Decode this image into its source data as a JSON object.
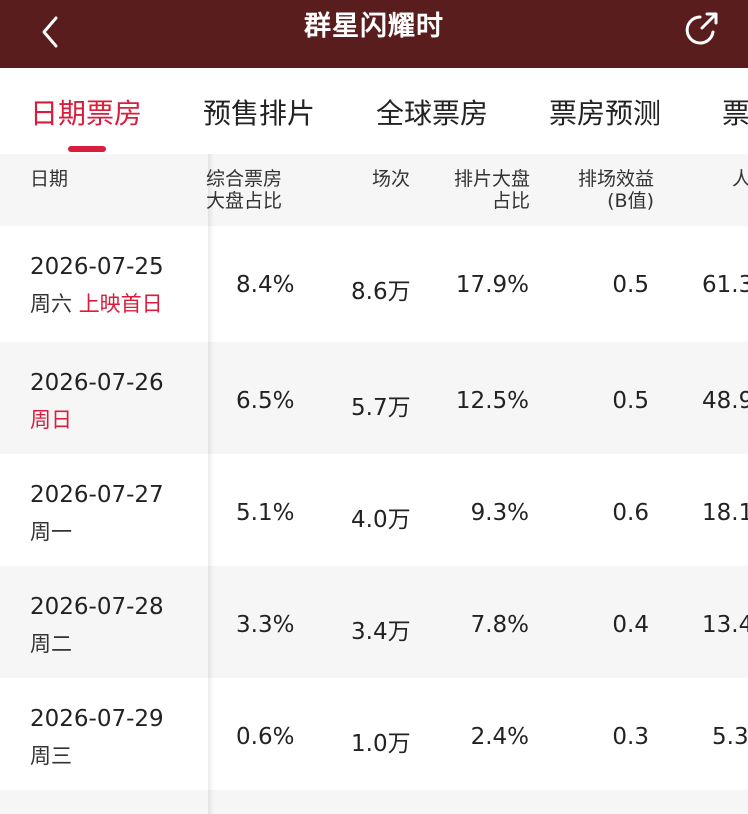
{
  "header": {
    "title": "群星闪耀时"
  },
  "tabs": [
    "日期票房",
    "预售排片",
    "全球票房",
    "票房预测",
    "票"
  ],
  "columns": {
    "date": "日期",
    "share_line1": "综合票房",
    "share_line2": "大盘占比",
    "sessions": "场次",
    "schedule_line1": "排片大盘",
    "schedule_line2": "占比",
    "efficiency_line1": "排场效益",
    "efficiency_line2": "(B值)",
    "people": "人"
  },
  "rows": [
    {
      "date": "2026-07-25",
      "weekday": "周六",
      "note": "上映首日",
      "weekday_red": false,
      "share": "8.4%",
      "sessions": "8.6万",
      "schedule": "17.9%",
      "efficiency": "0.5",
      "people": "61.3"
    },
    {
      "date": "2026-07-26",
      "weekday": "周日",
      "note": "",
      "weekday_red": true,
      "share": "6.5%",
      "sessions": "5.7万",
      "schedule": "12.5%",
      "efficiency": "0.5",
      "people": "48.9"
    },
    {
      "date": "2026-07-27",
      "weekday": "周一",
      "note": "",
      "weekday_red": false,
      "share": "5.1%",
      "sessions": "4.0万",
      "schedule": "9.3%",
      "efficiency": "0.6",
      "people": "18.1"
    },
    {
      "date": "2026-07-28",
      "weekday": "周二",
      "note": "",
      "weekday_red": false,
      "share": "3.3%",
      "sessions": "3.4万",
      "schedule": "7.8%",
      "efficiency": "0.4",
      "people": "13.4"
    },
    {
      "date": "2026-07-29",
      "weekday": "周三",
      "note": "",
      "weekday_red": false,
      "share": "0.6%",
      "sessions": "1.0万",
      "schedule": "2.4%",
      "efficiency": "0.3",
      "people": "5.3"
    }
  ],
  "colors": {
    "header_bg": "#5a1d1d",
    "accent": "#d81e3c"
  }
}
